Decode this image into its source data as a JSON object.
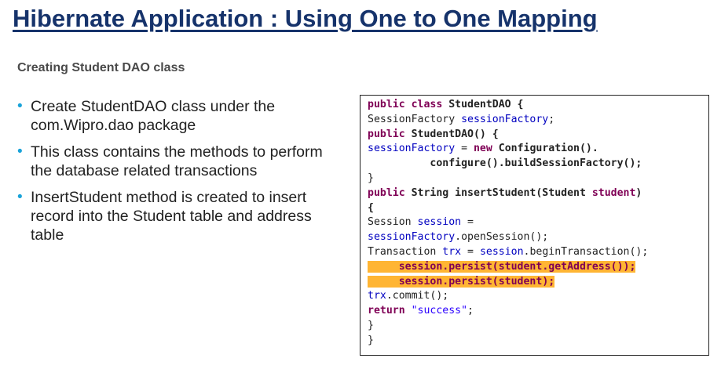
{
  "slide": {
    "title": "Hibernate Application : Using One to One Mapping",
    "subtitle": "Creating Student DAO class",
    "bullets": [
      "Create StudentDAO class under the com.Wipro.dao package",
      "This class contains the methods to perform the database related transactions",
      "InsertStudent method is created to insert record into the Student table and address table"
    ],
    "bullet_color": "#1aa3d9",
    "title_color": "#16336b",
    "highlight_color": "#ffb533"
  },
  "code": {
    "l1": {
      "kw": "public class ",
      "name": "StudentDAO {"
    },
    "l2": {
      "type": "SessionFactory ",
      "var": "sessionFactory",
      "end": ";"
    },
    "l3": {
      "kw": "public ",
      "name": "StudentDAO() {"
    },
    "l4": {
      "var": "sessionFactory",
      "eq": " = ",
      "kw": "new ",
      "name": "Configuration()."
    },
    "l5": {
      "indent": "          ",
      "text": "configure().buildSessionFactory();"
    },
    "l6": {
      "text": "}"
    },
    "l7": {
      "kw": "public ",
      "name": "String insertStudent(Student ",
      "param": "student",
      "end": ")"
    },
    "l8": {
      "text": "{"
    },
    "l9": {
      "type": "Session ",
      "var": "session",
      "end": " ="
    },
    "l10": {
      "var": "sessionFactory",
      "end": ".openSession();"
    },
    "l11": {
      "type": "Transaction ",
      "var": "trx",
      "mid": " = ",
      "var2": "session",
      "end": ".beginTransaction();"
    },
    "l12": {
      "indent": "     ",
      "text": "session.persist(student.getAddress());"
    },
    "l13": {
      "indent": "     ",
      "text": "session.persist(student);"
    },
    "l14": {
      "var": "trx",
      "end": ".commit();"
    },
    "l15": {
      "kw": "return ",
      "str": "\"success\"",
      "end": ";"
    },
    "l16": {
      "text": "}"
    },
    "l17": {
      "text": "}"
    }
  }
}
